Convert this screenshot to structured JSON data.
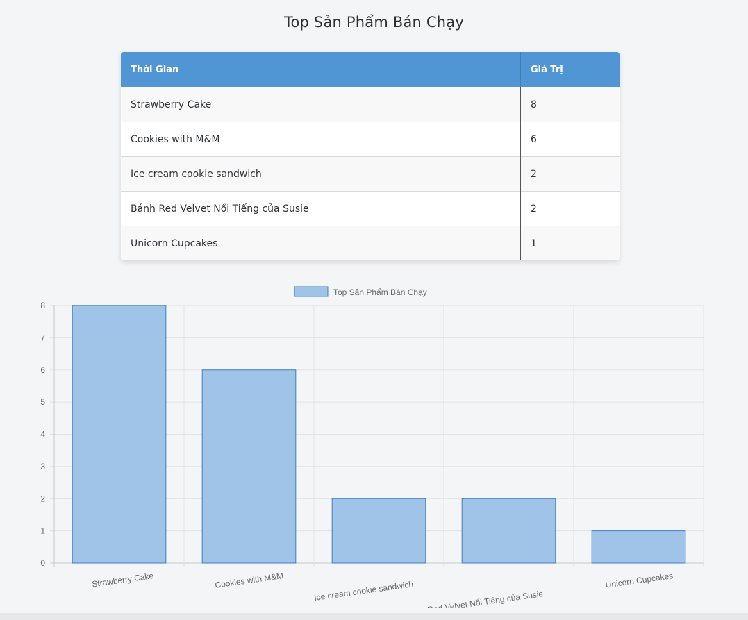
{
  "title": "Top Sản Phẩm Bán Chạy",
  "table": {
    "headers": {
      "name": "Thời Gian",
      "value": "Giá Trị"
    },
    "rows": [
      {
        "name": "Strawberry Cake",
        "value": "8"
      },
      {
        "name": "Cookies with M&M",
        "value": "6"
      },
      {
        "name": "Ice cream cookie sandwich",
        "value": "2"
      },
      {
        "name": "Bánh Red Velvet Nổi Tiếng của Susie",
        "value": "2"
      },
      {
        "name": "Unicorn Cupcakes",
        "value": "1"
      }
    ]
  },
  "chart_data": {
    "type": "bar",
    "categories": [
      "Strawberry Cake",
      "Cookies with M&M",
      "Ice cream cookie sandwich",
      "Bánh Red Velvet Nổi Tiếng của Susie",
      "Unicorn Cupcakes"
    ],
    "series": [
      {
        "name": "Top Sản Phẩm Bán Chạy",
        "values": [
          8,
          6,
          2,
          2,
          1
        ]
      }
    ],
    "title": "",
    "xlabel": "",
    "ylabel": "",
    "ylim": [
      0,
      8
    ],
    "yticks": [
      0,
      1,
      2,
      3,
      4,
      5,
      6,
      7,
      8
    ],
    "grid": true,
    "legend": "top-center",
    "colors": {
      "bar_fill": "#a0c4e7",
      "bar_border": "#3b7fc2",
      "grid": "#e2e2e2",
      "axis": "#c9c9c9",
      "tick_text": "#666666"
    }
  }
}
